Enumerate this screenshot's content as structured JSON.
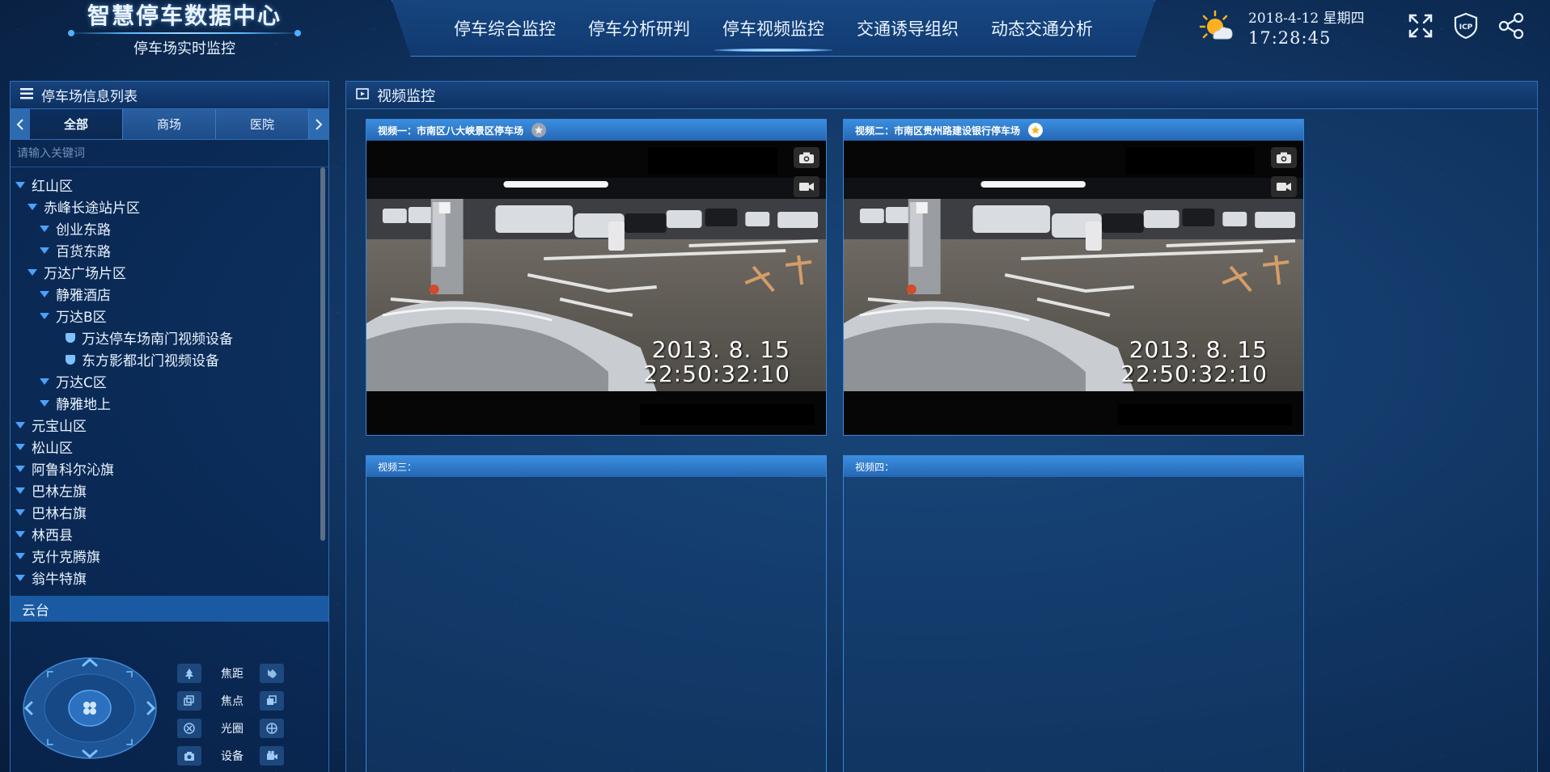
{
  "header": {
    "title": "智慧停车数据中心",
    "subtitle": "停车场实时监控",
    "date": "2018-4-12  星期四",
    "time": "17:28:45",
    "weather_icon": "partly-sunny-icon",
    "icons": [
      "fullscreen-icon",
      "icp-shield-icon",
      "share-network-icon"
    ]
  },
  "nav": {
    "items": [
      {
        "label": "停车综合监控"
      },
      {
        "label": "停车分析研判"
      },
      {
        "label": "停车视频监控",
        "active": true
      },
      {
        "label": "交通诱导组织"
      },
      {
        "label": "动态交通分析"
      }
    ]
  },
  "left": {
    "title": "停车场信息列表",
    "tabs": [
      {
        "label": "全部",
        "active": true
      },
      {
        "label": "商场"
      },
      {
        "label": "医院"
      }
    ],
    "search_placeholder": "请输入关键词",
    "tree": [
      {
        "label": "红山区",
        "level": 0,
        "type": "folder"
      },
      {
        "label": "赤峰长途站片区",
        "level": 1,
        "type": "folder"
      },
      {
        "label": "创业东路",
        "level": 2,
        "type": "folder"
      },
      {
        "label": "百货东路",
        "level": 2,
        "type": "folder"
      },
      {
        "label": "万达广场片区",
        "level": 1,
        "type": "folder"
      },
      {
        "label": "静雅酒店",
        "level": 2,
        "type": "folder"
      },
      {
        "label": "万达B区",
        "level": 2,
        "type": "folder"
      },
      {
        "label": "万达停车场南门视频设备",
        "level": 3,
        "type": "device"
      },
      {
        "label": "东方影都北门视频设备",
        "level": 3,
        "type": "device"
      },
      {
        "label": "万达C区",
        "level": 2,
        "type": "folder"
      },
      {
        "label": "静雅地上",
        "level": 2,
        "type": "folder"
      },
      {
        "label": "元宝山区",
        "level": 0,
        "type": "folder"
      },
      {
        "label": "松山区",
        "level": 0,
        "type": "folder"
      },
      {
        "label": "阿鲁科尔沁旗",
        "level": 0,
        "type": "folder"
      },
      {
        "label": "巴林左旗",
        "level": 0,
        "type": "folder"
      },
      {
        "label": "巴林右旗",
        "level": 0,
        "type": "folder"
      },
      {
        "label": "林西县",
        "level": 0,
        "type": "folder"
      },
      {
        "label": "克什克腾旗",
        "level": 0,
        "type": "folder"
      },
      {
        "label": "翁牛特旗",
        "level": 0,
        "type": "folder"
      }
    ],
    "ptz": {
      "title": "云台",
      "controls": [
        {
          "label": "焦距",
          "minus_icon": "zoom-tree-small-icon",
          "plus_icon": "zoom-tree-large-icon"
        },
        {
          "label": "焦点",
          "minus_icon": "focus-near-icon",
          "plus_icon": "focus-far-icon"
        },
        {
          "label": "光圈",
          "minus_icon": "iris-close-icon",
          "plus_icon": "iris-open-icon"
        },
        {
          "label": "设备",
          "minus_icon": "snapshot-icon",
          "plus_icon": "record-icon"
        }
      ]
    }
  },
  "right": {
    "title": "视频监控",
    "videos": [
      {
        "title": "视频一：市南区八大峡景区停车场",
        "favorite": false,
        "has_feed": true,
        "stamp_date": "2013. 8. 15",
        "stamp_time": "22:50:32:10"
      },
      {
        "title": "视频二：市南区贵州路建设银行停车场",
        "favorite": true,
        "has_feed": true,
        "stamp_date": "2013. 8. 15",
        "stamp_time": "22:50:32:10"
      },
      {
        "title": "视频三：",
        "favorite": false,
        "has_feed": false
      },
      {
        "title": "视频四：",
        "favorite": false,
        "has_feed": false
      }
    ]
  },
  "colors": {
    "background": "#143c6c",
    "panel_border": "#2f6fb8",
    "tree_caret": "#4aa2ff",
    "video_header": "#2d78c8",
    "favorite_star": "#f0b420"
  }
}
